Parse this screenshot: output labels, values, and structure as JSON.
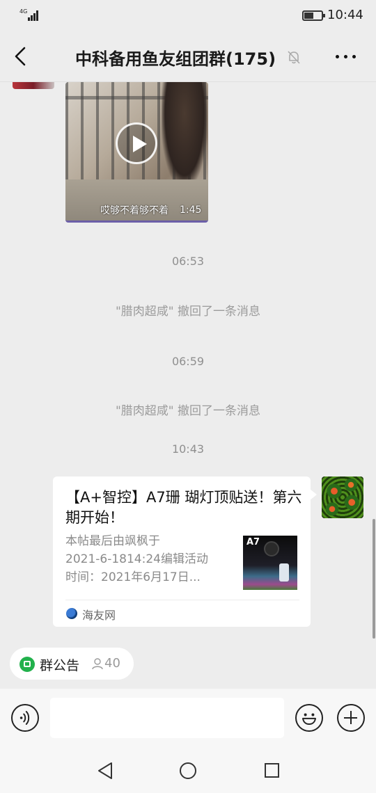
{
  "status_bar": {
    "network": "4G",
    "battery_level": 0.55,
    "time": "10:44"
  },
  "header": {
    "title": "中科备用鱼友组团群(175)",
    "icons": [
      "back-arrow-icon",
      "mute-bell-icon",
      "more-dots-icon"
    ]
  },
  "messages": {
    "video": {
      "caption": "哎够不着够不着",
      "duration": "1:45"
    },
    "time_1": "06:53",
    "recall_1": "\"腊肉超咸\" 撤回了一条消息",
    "time_2": "06:59",
    "recall_2": "\"腊肉超咸\" 撤回了一条消息",
    "time_3": "10:43",
    "link_card": {
      "title": "【A+智控】A7珊 瑚灯顶贴送！第六期开始！",
      "desc_line_1": "本帖最后由飒枫于",
      "desc_line_2": "2021-6-1814:24编辑活动",
      "desc_line_3": "时间：2021年6月17日...",
      "thumb_text": "A7",
      "source": "海友网"
    }
  },
  "announcement": {
    "label": "群公告",
    "count": "40"
  },
  "input": {
    "placeholder": ""
  },
  "colors": {
    "background": "#ededed",
    "announce_green": "#22b14c",
    "system_text": "#9b9b9b"
  }
}
